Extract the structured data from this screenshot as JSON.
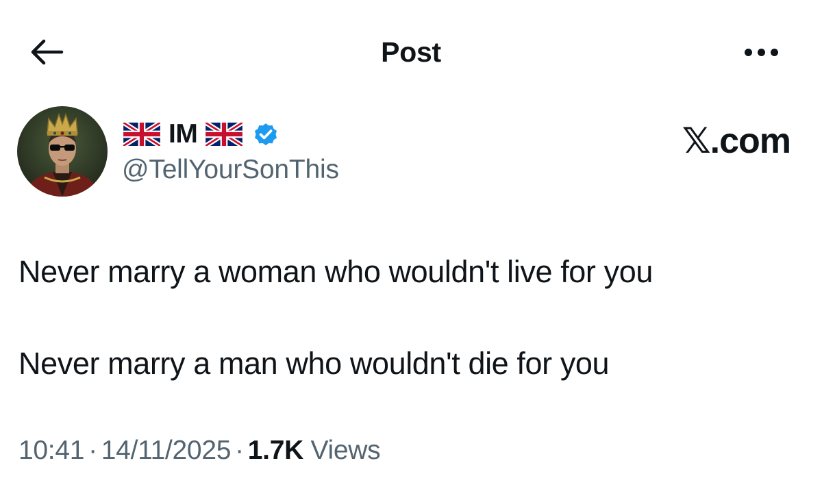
{
  "header": {
    "title": "Post",
    "back_icon": "arrow-left-icon",
    "more_icon": "more-horizontal-icon"
  },
  "author": {
    "name": "IM",
    "flag_icon": "uk-flag-icon",
    "verified_icon": "verified-badge-icon",
    "handle": "@TellYourSonThis"
  },
  "watermark": "𝕏.com",
  "post": {
    "lines": [
      "Never marry a woman who wouldn't live for you",
      "Never marry a man who wouldn't die for you"
    ]
  },
  "meta": {
    "time": "10:41",
    "separator": "·",
    "date": "14/11/2025",
    "views_count": "1.7K",
    "views_label": "Views"
  },
  "colors": {
    "text_primary": "#0f1419",
    "text_secondary": "#536471",
    "verified_blue": "#1d9bf0",
    "flag_blue": "#012169",
    "flag_red": "#C8102E"
  }
}
